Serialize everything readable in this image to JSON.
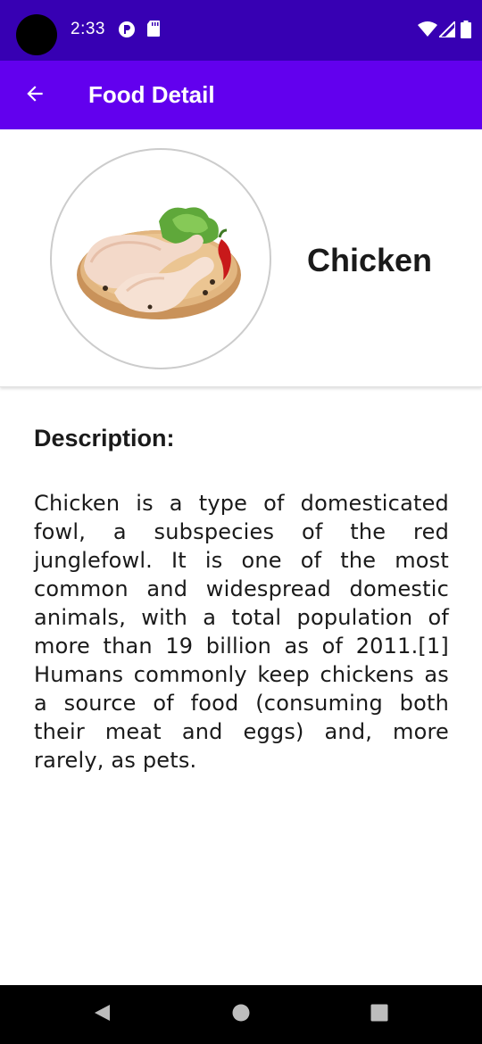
{
  "status_bar": {
    "time": "2:33",
    "icons": [
      "notification-badge-icon",
      "sd-card-icon",
      "wifi-icon",
      "cell-signal-icon",
      "battery-icon"
    ]
  },
  "app_bar": {
    "title": "Food Detail",
    "back_icon": "arrow-left-icon",
    "color": "#6200ee",
    "status_color": "#3700b3"
  },
  "food": {
    "name": "Chicken",
    "image": "raw-chicken-legs-on-board-photo"
  },
  "description": {
    "heading": "Description:",
    "text": "Chicken is a type of domesticated fowl, a subspecies of the red junglefowl. It is one of the most common and widespread domestic animals, with a total population of more than 19 billion as of 2011.[1] Humans commonly keep chickens as a source of food (consuming both their meat and eggs) and, more rarely, as pets."
  },
  "nav_bar": {
    "buttons": [
      "back-triangle-icon",
      "home-circle-icon",
      "recents-square-icon"
    ]
  }
}
